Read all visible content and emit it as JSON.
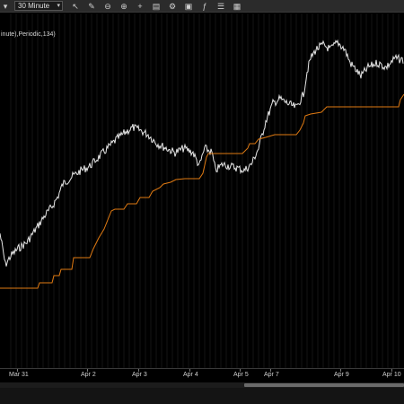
{
  "toolbar": {
    "interval_value": "30 Minute",
    "icons": [
      "instrument-dropdown-icon",
      "pencil-icon",
      "zoom-out-icon",
      "zoom-in-icon",
      "crosshair-icon",
      "strategy-icon",
      "settings-icon",
      "data-box-icon",
      "indicator-icon",
      "properties-icon",
      "layout-icon"
    ]
  },
  "indicator": {
    "label": "inute),Periodic,134)"
  },
  "x_axis": {
    "ticks": [
      "Mar 31",
      "Apr 2",
      "Apr 3",
      "Apr 4",
      "Apr 5",
      "Apr 7",
      "Apr 9",
      "Apr 10"
    ]
  },
  "colors": {
    "background": "#000000",
    "price": "#e6e6e6",
    "indicator": "#e07a12",
    "grid": "#141414",
    "toolbar": "#2b2b2b"
  }
}
